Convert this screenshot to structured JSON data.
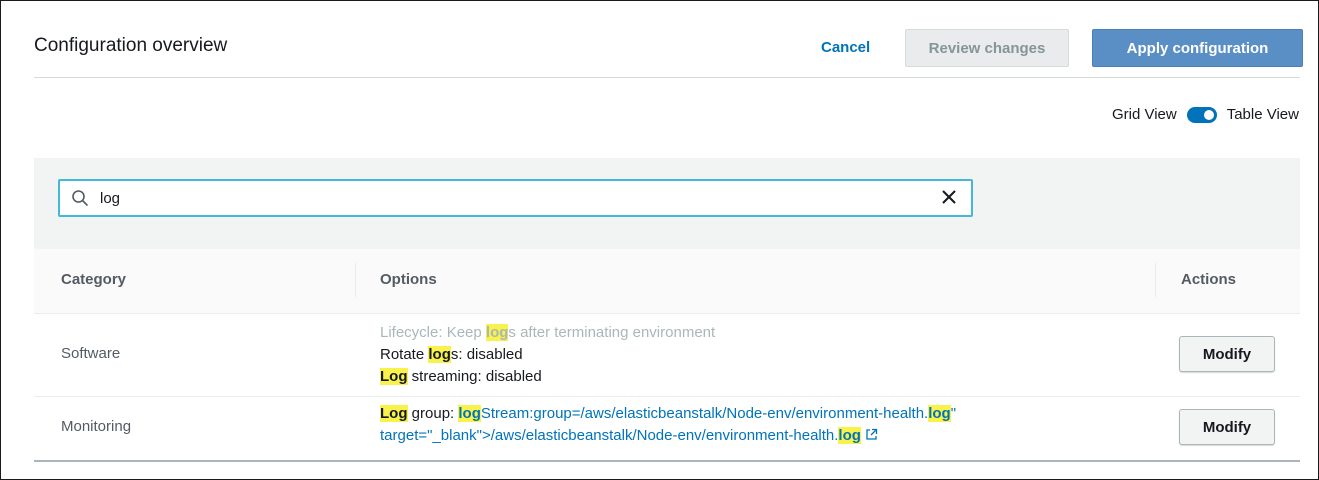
{
  "header": {
    "title": "Configuration overview",
    "cancel_label": "Cancel",
    "review_label": "Review changes",
    "apply_label": "Apply configuration"
  },
  "view_toggle": {
    "left_label": "Grid View",
    "right_label": "Table View",
    "state": "Table View"
  },
  "search": {
    "value": "log"
  },
  "table": {
    "columns": [
      "Category",
      "Options",
      "Actions"
    ],
    "rows": [
      {
        "category": "Software",
        "options": [
          {
            "before": "Lifecycle: Keep ",
            "hl": "log",
            "after": "s after terminating environment",
            "muted": true
          },
          {
            "before": "Rotate ",
            "hl": "log",
            "after": "s: disabled"
          },
          {
            "before": "",
            "hl": "Log",
            "after": " streaming: disabled"
          }
        ],
        "action_label": "Modify"
      },
      {
        "category": "Monitoring",
        "options": [
          {
            "hl1": "Log",
            "mid": " group: ",
            "hl2": "log",
            "link": "Stream:group=/aws/elasticbeanstalk/Node-env/environment-health.",
            "hl3": "log",
            "tail": "\""
          },
          {
            "link": "target=\"_blank\">/aws/elasticbeanstalk/Node-env/environment-health.",
            "hl": "log"
          }
        ],
        "action_label": "Modify"
      }
    ]
  },
  "colors": {
    "accent": "#0073bb",
    "apply_button": "#5a8fc6",
    "highlight": "#f8f24a",
    "search_border": "#44b9d6"
  }
}
